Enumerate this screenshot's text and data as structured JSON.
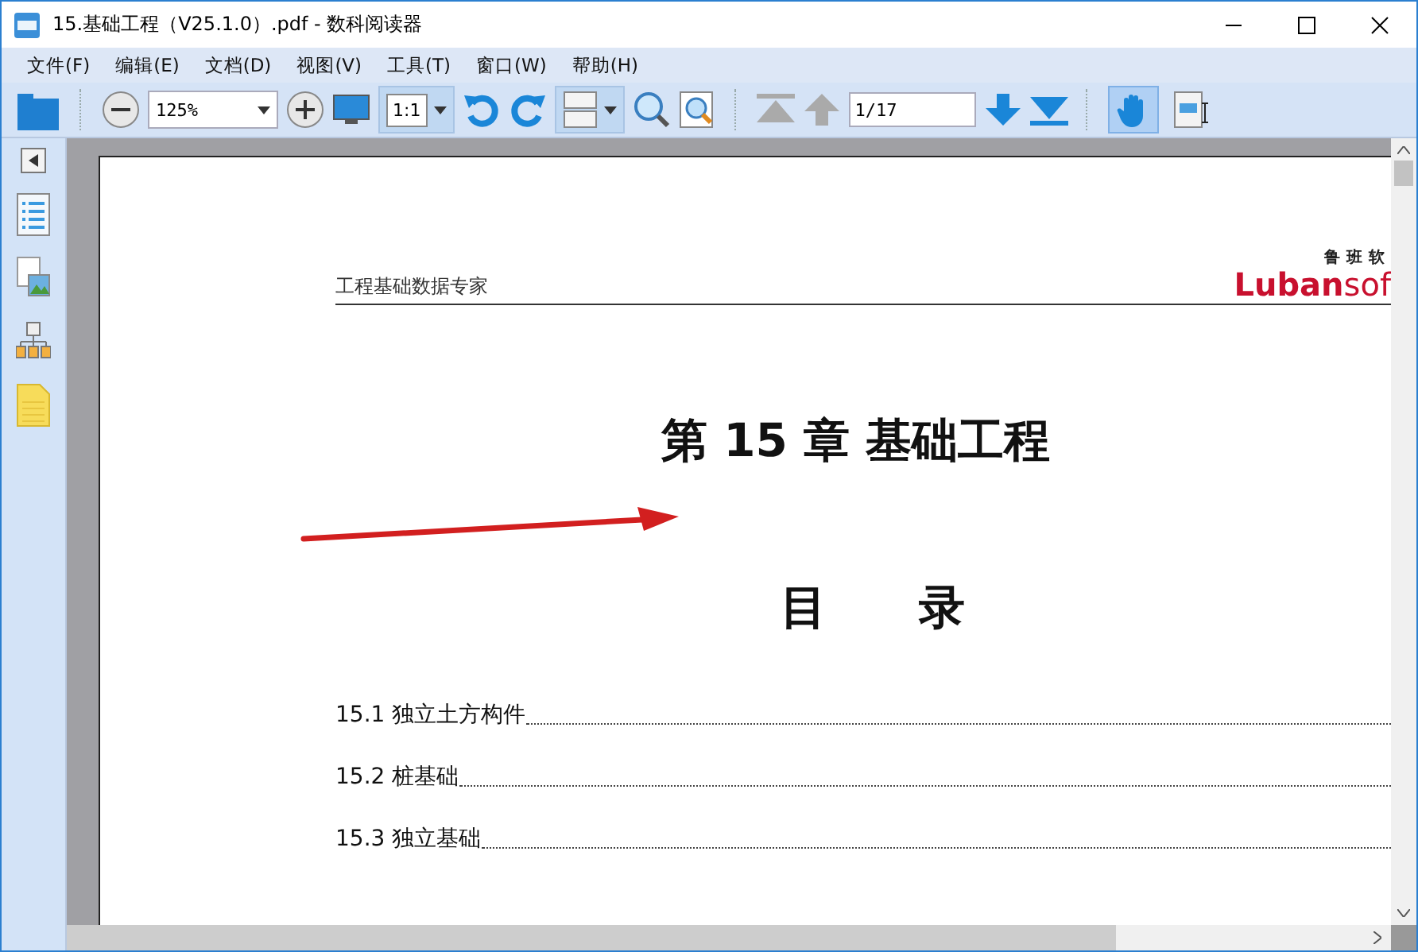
{
  "window": {
    "title": "15.基础工程（V25.1.0）.pdf - 数科阅读器"
  },
  "menu": [
    "文件(F)",
    "编辑(E)",
    "文档(D)",
    "视图(V)",
    "工具(T)",
    "窗口(W)",
    "帮助(H)"
  ],
  "toolbar": {
    "zoom": "125%",
    "ratio": "1:1",
    "page": "1/17",
    "tools": [
      {
        "kind": "hand",
        "selected": true
      },
      {
        "kind": "select-text",
        "selected": false
      }
    ]
  },
  "document": {
    "header": "工程基础数据专家",
    "logo_cn": "鲁班软",
    "logo_brand": "Luban",
    "logo_suffix": "sof",
    "chapter_title": "第 15 章  基础工程",
    "toc_heading": "目　　录",
    "toc": [
      "15.1 独立土方构件",
      "15.2 桩基础",
      "15.3 独立基础"
    ]
  }
}
